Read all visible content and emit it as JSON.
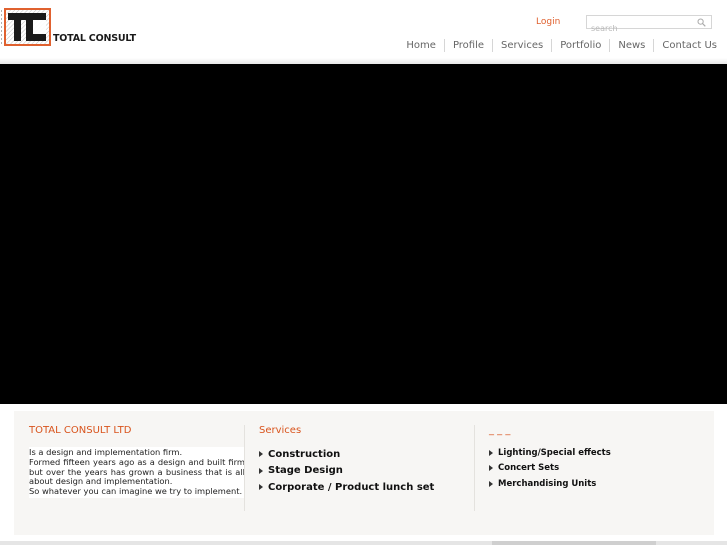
{
  "brand": {
    "name": "TOTAL CONSULT",
    "accent_color": "#e0612f",
    "logo_icon": "tc-monogram-logo"
  },
  "header": {
    "login_label": "Login",
    "search_placeholder": "search",
    "search_icon": "search-icon"
  },
  "nav": {
    "items": [
      {
        "label": "Home"
      },
      {
        "label": "Profile"
      },
      {
        "label": "Services"
      },
      {
        "label": "Portfolio"
      },
      {
        "label": "News"
      },
      {
        "label": "Contact Us"
      }
    ]
  },
  "about": {
    "title": "TOTAL CONSULT LTD",
    "lines": [
      "Is a design and implementation firm.",
      "Formed fifteen years ago as a design and built firm but over the years has grown a business that is all about design and implementation.",
      "So whatever you can imagine we try to implement."
    ]
  },
  "services": {
    "title": "Services",
    "items": [
      "Construction",
      "Stage Design",
      "Corporate / Product lunch set"
    ]
  },
  "more": {
    "title": "_ _ _",
    "items": [
      "Lighting/Special effects",
      "Concert Sets",
      "Merchandising Units"
    ]
  },
  "colors": {
    "heading": "#d9541d",
    "media_background": "#000000",
    "panel_background": "#f7f6f4"
  }
}
